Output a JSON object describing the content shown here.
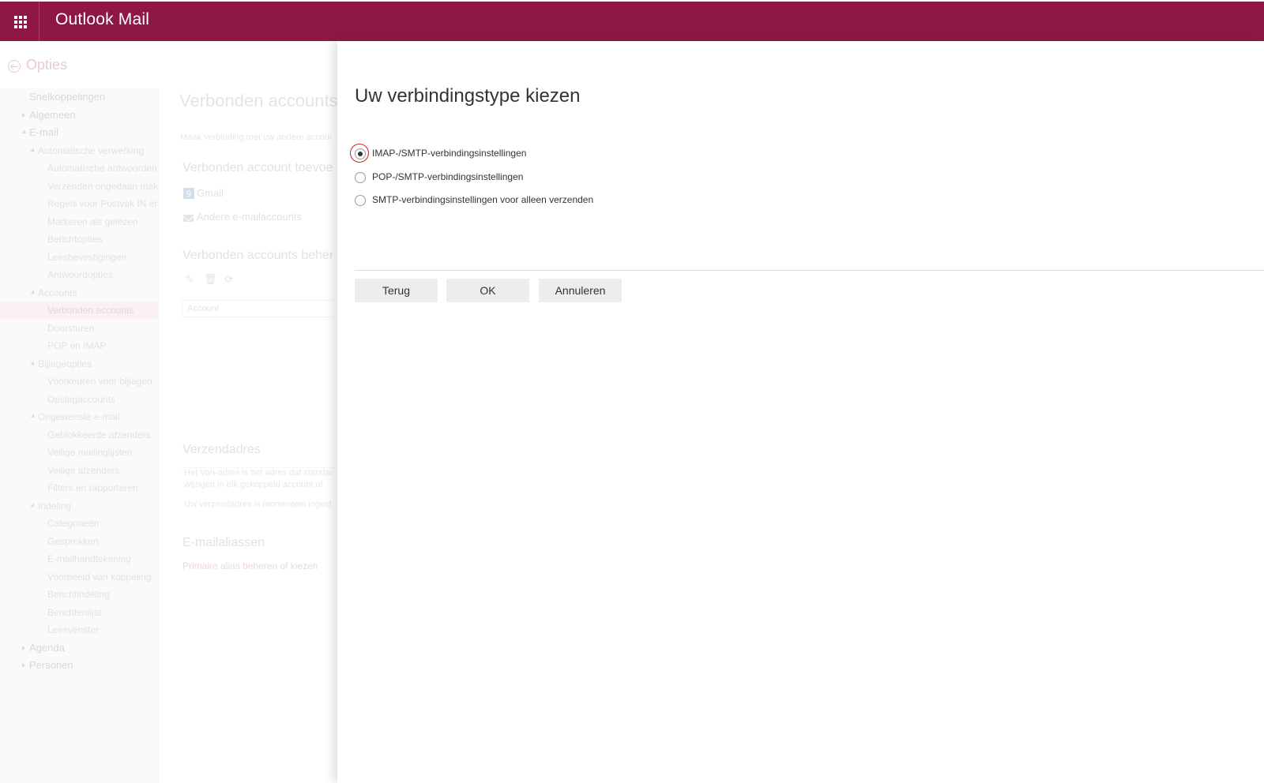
{
  "app": {
    "title": "Outlook Mail"
  },
  "options": {
    "title": "Opties"
  },
  "nav": {
    "items": [
      {
        "label": "Snelkoppelingen",
        "level": 0,
        "expander": "none"
      },
      {
        "label": "Algemeen",
        "level": 0,
        "expander": "collapsed"
      },
      {
        "label": "E-mail",
        "level": 0,
        "expander": "expanded"
      },
      {
        "label": "Automatische verwerking",
        "level": 1,
        "expander": "expanded"
      },
      {
        "label": "Automatische antwoorden",
        "level": 2,
        "expander": "none"
      },
      {
        "label": "Verzenden ongedaan maken",
        "level": 2,
        "expander": "none"
      },
      {
        "label": "Regels voor Postvak IN en",
        "level": 2,
        "expander": "none"
      },
      {
        "label": "Markeren als gelezen",
        "level": 2,
        "expander": "none"
      },
      {
        "label": "Berichtopties",
        "level": 2,
        "expander": "none"
      },
      {
        "label": "Leesbevestigingen",
        "level": 2,
        "expander": "none"
      },
      {
        "label": "Antwoordopties",
        "level": 2,
        "expander": "none"
      },
      {
        "label": "Accounts",
        "level": 1,
        "expander": "expanded"
      },
      {
        "label": "Verbonden accounts",
        "level": 2,
        "expander": "none",
        "selected": true
      },
      {
        "label": "Doorsturen",
        "level": 2,
        "expander": "none"
      },
      {
        "label": "POP en IMAP",
        "level": 2,
        "expander": "none"
      },
      {
        "label": "Bijlageopties",
        "level": 1,
        "expander": "expanded"
      },
      {
        "label": "Voorkeuren voor bijlagen",
        "level": 2,
        "expander": "none"
      },
      {
        "label": "Opslagaccounts",
        "level": 2,
        "expander": "none"
      },
      {
        "label": "Ongewenste e-mail",
        "level": 1,
        "expander": "expanded"
      },
      {
        "label": "Geblokkeerde afzenders",
        "level": 2,
        "expander": "none"
      },
      {
        "label": "Veilige mailinglijsten",
        "level": 2,
        "expander": "none"
      },
      {
        "label": "Veilige afzenders",
        "level": 2,
        "expander": "none"
      },
      {
        "label": "Filters en rapporteren",
        "level": 2,
        "expander": "none"
      },
      {
        "label": "Indeling",
        "level": 1,
        "expander": "expanded"
      },
      {
        "label": "Categorieën",
        "level": 2,
        "expander": "none"
      },
      {
        "label": "Gesprekken",
        "level": 2,
        "expander": "none"
      },
      {
        "label": "E-mailhandtekening",
        "level": 2,
        "expander": "none"
      },
      {
        "label": "Voorbeeld van koppeling",
        "level": 2,
        "expander": "none"
      },
      {
        "label": "Berichtindeling",
        "level": 2,
        "expander": "none"
      },
      {
        "label": "Berichtenlijst",
        "level": 2,
        "expander": "none"
      },
      {
        "label": "Leesvenster",
        "level": 2,
        "expander": "none"
      },
      {
        "label": "Agenda",
        "level": 0,
        "expander": "collapsed"
      },
      {
        "label": "Personen",
        "level": 0,
        "expander": "collapsed"
      }
    ]
  },
  "content": {
    "title": "Verbonden accounts",
    "description": "Maak verbinding met uw andere accounts",
    "add_section": "Verbonden account toevoegen",
    "gmail": "Gmail",
    "other_accounts": "Andere e-mailaccounts",
    "manage_section": "Verbonden accounts beheren",
    "account_column": "Account",
    "send_address_title": "Verzendadres",
    "send_address_desc1": "Het Van-adres is het adres dat standaard",
    "send_address_desc2": "wijzigen in elk gekoppeld account of",
    "send_address_current": "Uw verzendadres is momenteel ingesteld",
    "aliases_title": "E-mailaliassen",
    "aliases_link": "Primaire alias beheren of kiezen"
  },
  "dialog": {
    "title": "Uw verbindingstype kiezen",
    "options": [
      {
        "label": "IMAP-/SMTP-verbindingsinstellingen",
        "checked": true
      },
      {
        "label": "POP-/SMTP-verbindingsinstellingen",
        "checked": false
      },
      {
        "label": "SMTP-verbindingsinstellingen voor alleen verzenden",
        "checked": false
      }
    ],
    "buttons": {
      "back": "Terug",
      "ok": "OK",
      "cancel": "Annuleren"
    }
  },
  "colors": {
    "brand": "#8e1745",
    "accent_soft": "#c98aa2",
    "selected_bg": "#f5dde6"
  }
}
